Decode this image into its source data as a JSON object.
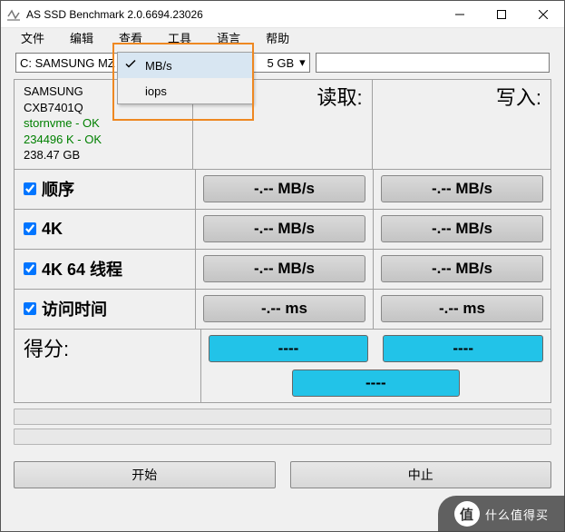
{
  "titlebar": {
    "title": "AS SSD Benchmark 2.0.6694.23026"
  },
  "menu": {
    "file": "文件",
    "edit": "编辑",
    "view": "查看",
    "tools": "工具",
    "language": "语言",
    "help": "帮助"
  },
  "view_dropdown": {
    "mbs": "MB/s",
    "iops": "iops"
  },
  "toolbar": {
    "drive": "C: SAMSUNG MZ",
    "size": "5 GB"
  },
  "device": {
    "name": "SAMSUNG",
    "model": "CXB7401Q",
    "driver": "stornvme - OK",
    "align": "234496 K - OK",
    "capacity": "238.47 GB"
  },
  "headers": {
    "read": "读取:",
    "write": "写入:"
  },
  "tests": {
    "seq": {
      "label": "顺序",
      "read": "-.-- MB/s",
      "write": "-.-- MB/s"
    },
    "fk": {
      "label": "4K",
      "read": "-.-- MB/s",
      "write": "-.-- MB/s"
    },
    "fk64": {
      "label": "4K 64 线程",
      "read": "-.-- MB/s",
      "write": "-.-- MB/s"
    },
    "acc": {
      "label": "访问时间",
      "read": "-.-- ms",
      "write": "-.-- ms"
    }
  },
  "score": {
    "label": "得分:",
    "read": "----",
    "write": "----",
    "total": "----"
  },
  "buttons": {
    "start": "开始",
    "abort": "中止"
  },
  "watermark": {
    "icon": "值",
    "text": "什么值得买"
  }
}
